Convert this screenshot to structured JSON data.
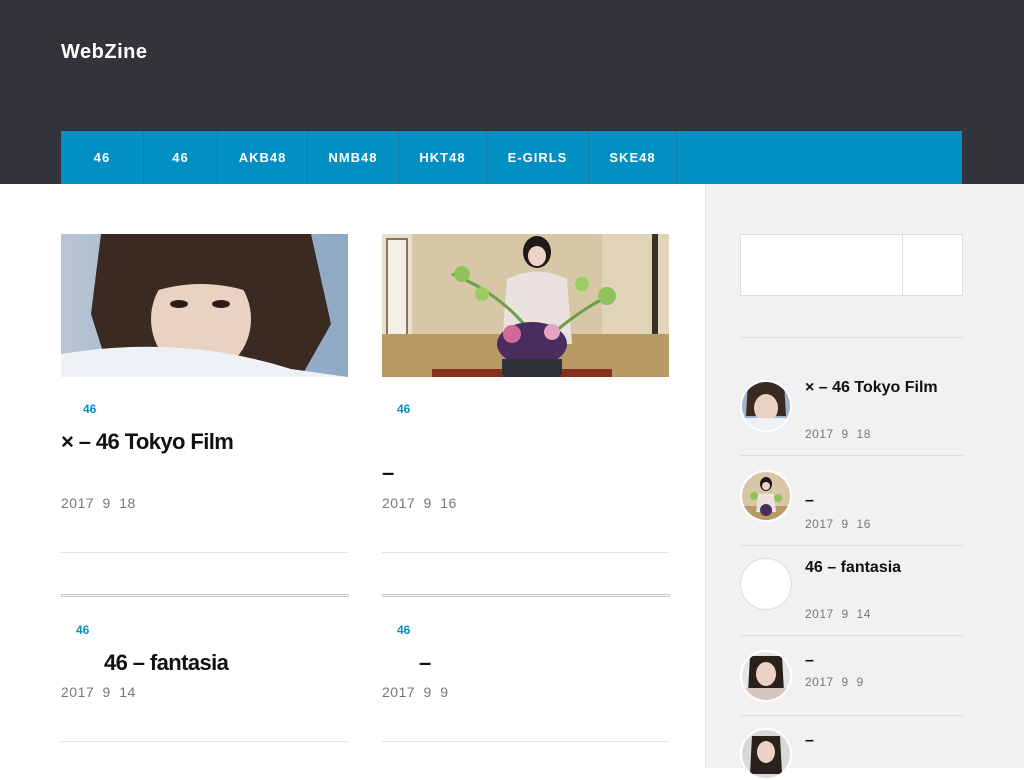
{
  "site": {
    "title": "WebZine"
  },
  "nav": {
    "items": [
      "46",
      "46",
      "AKB48",
      "NMB48",
      "HKT48",
      "E-GIRLS",
      "SKE48"
    ]
  },
  "posts": [
    {
      "category": "46",
      "title": "× – 46 Tokyo Film",
      "date": "2017 9 18"
    },
    {
      "category": "46",
      "title": "–",
      "date": "2017 9 16"
    },
    {
      "category": "46",
      "title": "46 – fantasia",
      "date": "2017 9 14"
    },
    {
      "category": "46",
      "title": "–",
      "date": "2017 9 9"
    }
  ],
  "sidebar": {
    "recent": [
      {
        "title": "× – 46 Tokyo Film",
        "date": "2017 9 18"
      },
      {
        "title": "–",
        "date": "2017 9 16"
      },
      {
        "title": "46 – fantasia",
        "date": "2017 9 14"
      },
      {
        "title": "–",
        "date": "2017 9 9"
      },
      {
        "title": "–",
        "date": ""
      }
    ]
  },
  "colors": {
    "header": "#323439",
    "nav": "#0190c1",
    "accent": "#0190c1",
    "sidebar_bg": "#f1f1f1"
  }
}
